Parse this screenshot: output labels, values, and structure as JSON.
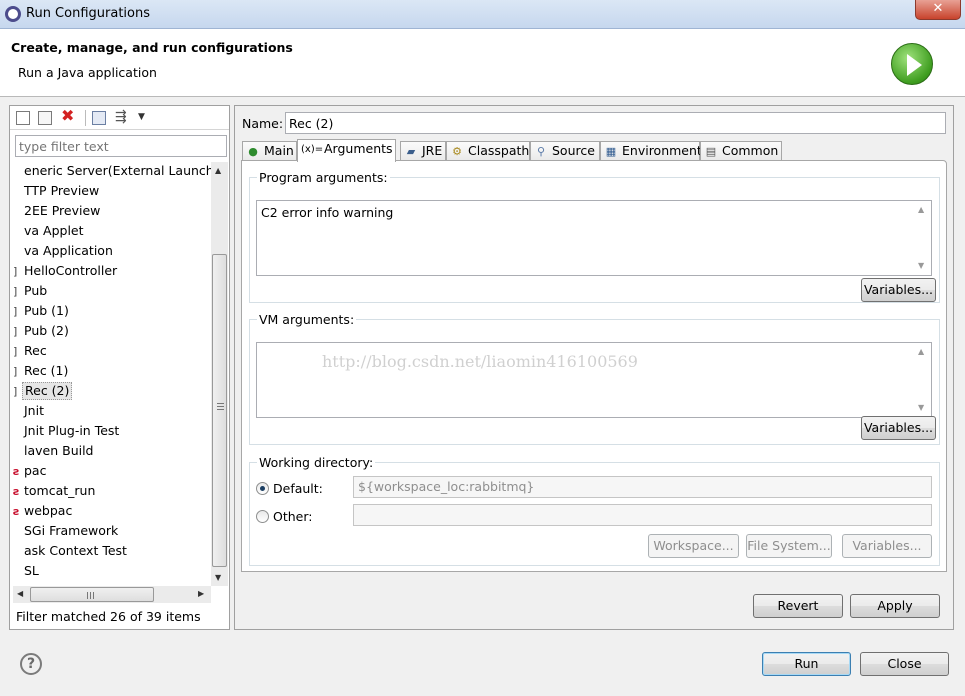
{
  "window": {
    "title": "Run Configurations",
    "close_glyph": "✕"
  },
  "header": {
    "title": "Create, manage, and run configurations",
    "subtitle": "Run a Java application"
  },
  "left": {
    "filter_placeholder": "type filter text",
    "items": [
      {
        "marker": "",
        "label": "eneric Server(External Launch)"
      },
      {
        "marker": "",
        "label": "TTP Preview"
      },
      {
        "marker": "",
        "label": "2EE Preview"
      },
      {
        "marker": "",
        "label": "va Applet"
      },
      {
        "marker": "",
        "label": "va Application"
      },
      {
        "marker": "]",
        "label": "HelloController"
      },
      {
        "marker": "]",
        "label": "Pub"
      },
      {
        "marker": "]",
        "label": "Pub (1)"
      },
      {
        "marker": "]",
        "label": "Pub (2)"
      },
      {
        "marker": "]",
        "label": "Rec"
      },
      {
        "marker": "]",
        "label": "Rec (1)"
      },
      {
        "marker": "]",
        "label": "Rec (2)",
        "selected": true
      },
      {
        "marker": "",
        "label": "Jnit"
      },
      {
        "marker": "",
        "label": "Jnit Plug-in Test"
      },
      {
        "marker": "",
        "label": "laven Build"
      },
      {
        "marker": "ƨ",
        "label": "pac"
      },
      {
        "marker": "ƨ",
        "label": "tomcat_run"
      },
      {
        "marker": "ƨ",
        "label": "webpac"
      },
      {
        "marker": "",
        "label": "SGi Framework"
      },
      {
        "marker": "",
        "label": "ask Context Test"
      },
      {
        "marker": "",
        "label": "SL"
      }
    ],
    "status": "Filter matched 26 of 39 items"
  },
  "config": {
    "name_label": "Name:",
    "name_value": "Rec (2)",
    "tabs": [
      {
        "label": "Main",
        "icon": "main-tab-icon",
        "glyph": "●"
      },
      {
        "label": "Arguments",
        "icon": "arguments-tab-icon",
        "glyph": "(x)="
      },
      {
        "label": "JRE",
        "icon": "jre-tab-icon",
        "glyph": "▰"
      },
      {
        "label": "Classpath",
        "icon": "classpath-tab-icon",
        "glyph": "⚙"
      },
      {
        "label": "Source",
        "icon": "source-tab-icon",
        "glyph": "⚲"
      },
      {
        "label": "Environment",
        "icon": "environment-tab-icon",
        "glyph": "▦"
      },
      {
        "label": "Common",
        "icon": "common-tab-icon",
        "glyph": "▤"
      }
    ],
    "program_args": {
      "title": "Program arguments:",
      "value": "C2 error info warning",
      "variables": "Variables..."
    },
    "vm_args": {
      "title": "VM arguments:",
      "value": "",
      "variables": "Variables..."
    },
    "watermark": "http://blog.csdn.net/liaomin416100569",
    "working_dir": {
      "title": "Working directory:",
      "default_label": "Default:",
      "default_value": "${workspace_loc:rabbitmq}",
      "other_label": "Other:",
      "other_value": "",
      "workspace_btn": "Workspace...",
      "filesystem_btn": "File System...",
      "variables_btn": "Variables..."
    },
    "revert": "Revert",
    "apply": "Apply"
  },
  "footer": {
    "help": "?",
    "run": "Run",
    "close": "Close"
  },
  "scroll": {
    "up": "▲",
    "down": "▼",
    "left": "◀",
    "right": "▶"
  }
}
